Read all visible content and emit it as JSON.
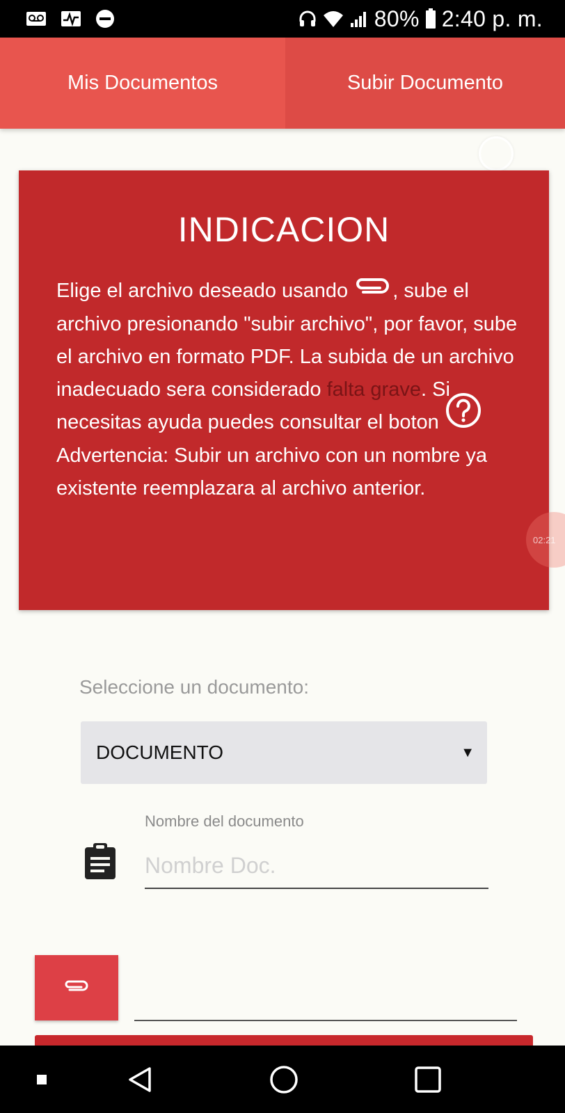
{
  "status_bar": {
    "battery": "80%",
    "time": "2:40 p. m.",
    "icons": [
      "voicemail-icon",
      "activity-icon",
      "do-not-disturb-icon",
      "headphones-icon",
      "wifi-icon",
      "signal-icon",
      "battery-icon"
    ]
  },
  "tabs": [
    {
      "label": "Mis Documentos"
    },
    {
      "label": "Subir Documento"
    }
  ],
  "card": {
    "title": "INDICACION",
    "line_1a": "Elige el archivo deseado usando ",
    "line_1b": ", sube el archivo presionando \"subir archivo\", por favor, sube el archivo en formato PDF. La subida de un archivo inadecuado sera considerado ",
    "highlight": "falta grave",
    "line_2": ". Si necesitas ayuda puedes consultar el boton ",
    "warning": "Advertencia: Subir un archivo con un nombre ya existente reemplazara al archivo anterior."
  },
  "overlay": {
    "badge_text": "02:21"
  },
  "form": {
    "select_label": "Seleccione un documento:",
    "select_value": "DOCUMENTO",
    "name_label": "Nombre del documento",
    "name_placeholder": "Nombre Doc."
  },
  "colors": {
    "accent": "#dd4b46",
    "card_bg": "#c1292b",
    "highlight_text": "#7a1416"
  },
  "nav_bar": {
    "icons": [
      "recents-dot-icon",
      "back-icon",
      "home-icon",
      "overview-icon"
    ]
  }
}
